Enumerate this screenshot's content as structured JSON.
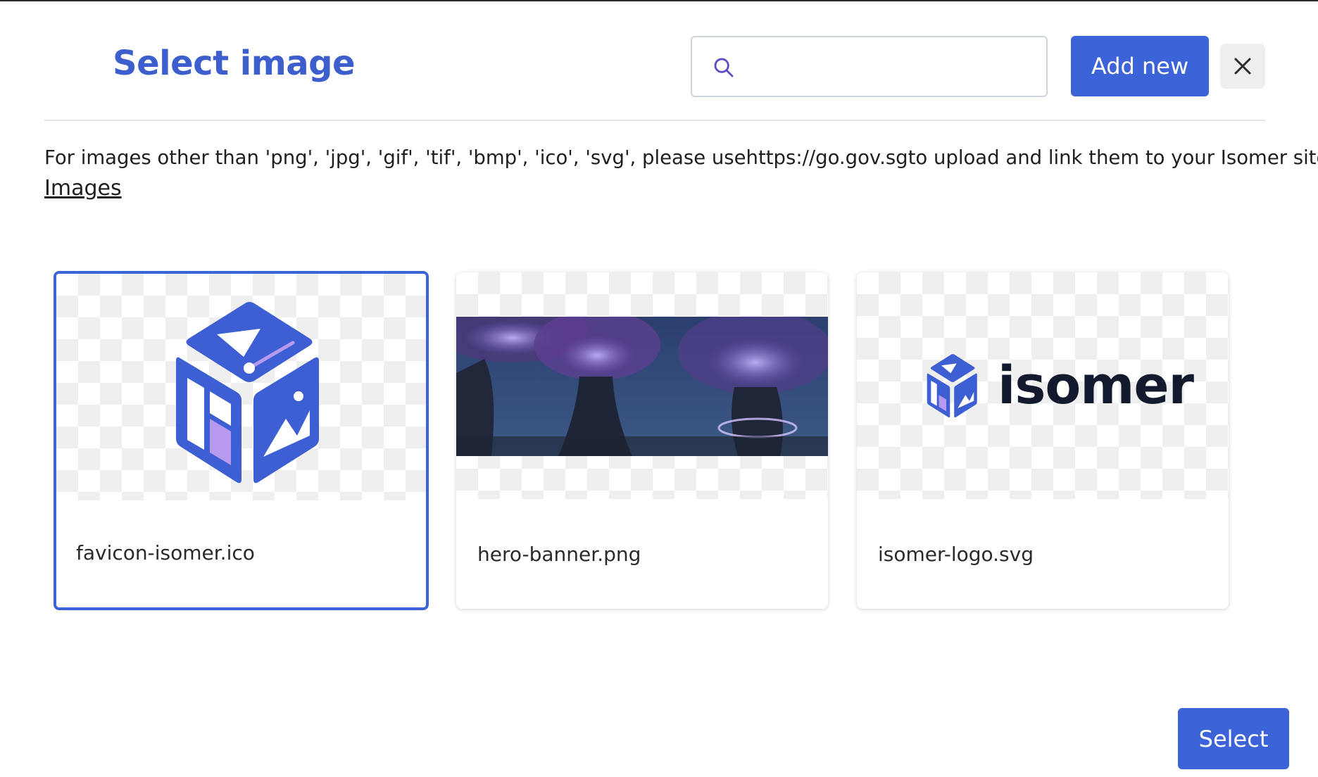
{
  "modal": {
    "title": "Select image",
    "search": {
      "placeholder": "",
      "value": ""
    },
    "add_new_label": "Add new",
    "info_text": "For images other than 'png', 'jpg', 'gif', 'tif', 'bmp', 'ico', 'svg', please usehttps://go.gov.sgto upload and link them to your Isomer site.",
    "section_label": "Images",
    "images": [
      {
        "name": "favicon-isomer.ico",
        "selected": true
      },
      {
        "name": "hero-banner.png",
        "selected": false
      },
      {
        "name": "isomer-logo.svg",
        "selected": false
      }
    ],
    "logo_wordmark": "isomer",
    "select_label": "Select"
  },
  "colors": {
    "accent": "#3c64d8",
    "title": "#3c5fcd",
    "logo_dark": "#141a2e",
    "logo_blue": "#3e5fd3",
    "logo_purple": "#b59af0"
  },
  "icons": {
    "search": "search-icon",
    "close": "close-icon"
  }
}
